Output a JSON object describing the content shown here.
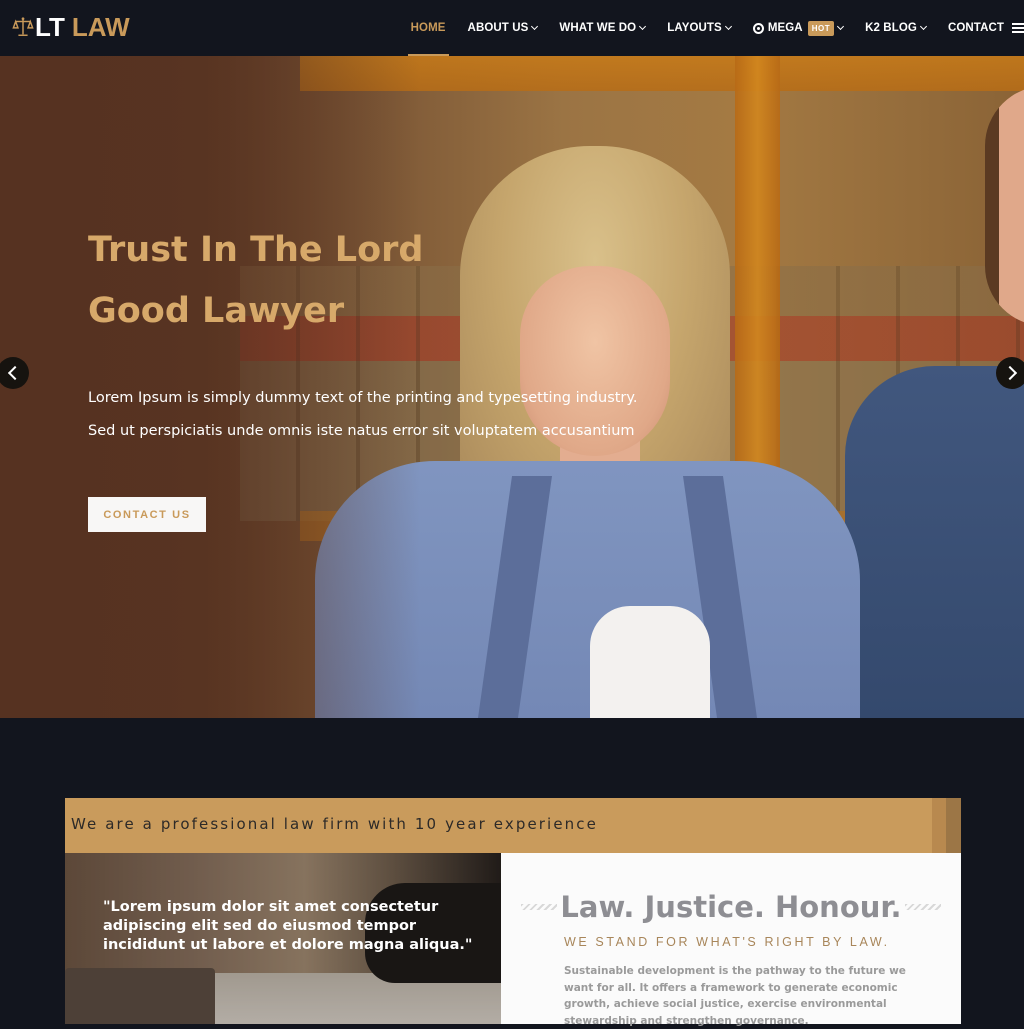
{
  "header": {
    "logo": {
      "icon": "scales-of-justice-icon",
      "part1": "LT",
      "part2": "LAW"
    },
    "nav": [
      {
        "label": "HOME",
        "active": true,
        "dropdown": false
      },
      {
        "label": "ABOUT US",
        "dropdown": true
      },
      {
        "label": "WHAT WE DO",
        "dropdown": true
      },
      {
        "label": "LAYOUTS",
        "dropdown": true
      },
      {
        "label": "MEGA",
        "badge": "HOT",
        "icon": "life-ring-icon",
        "dropdown": true
      },
      {
        "label": "K2 BLOG",
        "dropdown": true
      },
      {
        "label": "CONTACT",
        "dropdown": false
      }
    ],
    "menu_icon": "hamburger-menu-icon"
  },
  "hero": {
    "title_line1": "Trust In The Lord",
    "title_line2": "Good Lawyer",
    "text_line1": "Lorem Ipsum is simply dummy text of the printing and typesetting industry.",
    "text_line2": "Sed ut perspiciatis unde omnis iste natus error sit voluptatem accusantium",
    "button_label": "CONTACT US",
    "prev_icon": "chevron-left-icon",
    "next_icon": "chevron-right-icon"
  },
  "about": {
    "banner_text": "We are a professional law firm with 10 year experience",
    "quote": "\"Lorem ipsum dolor sit amet consectetur adipiscing elit sed do eiusmod tempor incididunt ut labore et dolore magna aliqua.\"",
    "quote_lines": [
      "\"Lorem ipsum dolor sit amet consectetur",
      "adipiscing elit sed do eiusmod tempor",
      "incididunt ut labore et dolore magna aliqua.\""
    ],
    "card_title": "Law. Justice. Honour.",
    "card_subtitle": "WE STAND FOR WHAT'S RIGHT BY LAW.",
    "card_body": "Sustainable development is the pathway to the future we want for all. It offers a framework to generate economic growth, achieve social justice, exercise environmental stewardship and strengthen governance."
  },
  "colors": {
    "accent_gold": "#c99a5a",
    "header_bg": "#12151e",
    "banner_bg": "#c99b5c",
    "card_title": "#8e8e93"
  }
}
